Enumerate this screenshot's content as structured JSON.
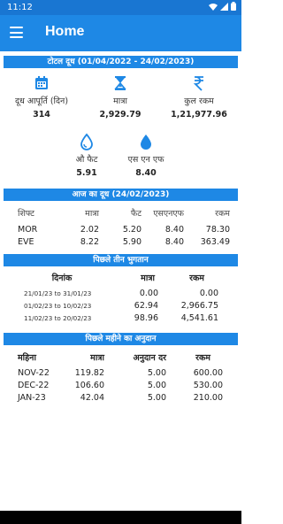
{
  "status": {
    "time": "11:12"
  },
  "app": {
    "title": "Home"
  },
  "total": {
    "heading": "टोटल दूध (01/04/2022 - 24/02/2023)",
    "stats": [
      {
        "label": "दूध आपूर्ति (दिन)",
        "value": "314",
        "icon": "calendar-icon"
      },
      {
        "label": "मात्रा",
        "value": "2,929.79",
        "icon": "hourglass-icon"
      },
      {
        "label": "कुल रकम",
        "value": "1,21,977.96",
        "icon": "rupee-icon"
      },
      {
        "label": "औ फैट",
        "value": "5.91",
        "icon": "drop-outline-icon"
      },
      {
        "label": "एस एन एफ",
        "value": "8.40",
        "icon": "drop-filled-icon"
      }
    ]
  },
  "today": {
    "heading": "आज का दूध (24/02/2023)",
    "headers": [
      "शिफ्ट",
      "मात्रा",
      "फैट",
      "एसएनएफ",
      "रकम"
    ],
    "rows": [
      [
        "MOR",
        "2.02",
        "5.20",
        "8.40",
        "78.30"
      ],
      [
        "EVE",
        "8.22",
        "5.90",
        "8.40",
        "363.49"
      ]
    ]
  },
  "payments": {
    "heading": "पिछले तीन भुगतान",
    "headers": [
      "दिनांक",
      "मात्रा",
      "रकम"
    ],
    "rows": [
      [
        "21/01/23 to 31/01/23",
        "0.00",
        "0.00"
      ],
      [
        "01/02/23 to 10/02/23",
        "62.94",
        "2,966.75"
      ],
      [
        "11/02/23 to 20/02/23",
        "98.96",
        "4,541.61"
      ]
    ]
  },
  "grant": {
    "heading": "पिछले महीने का अनुदान",
    "headers": [
      "महिना",
      "मात्रा",
      "अनुदान दर",
      "रकम"
    ],
    "rows": [
      [
        "NOV-22",
        "119.82",
        "5.00",
        "600.00"
      ],
      [
        "DEC-22",
        "106.60",
        "5.00",
        "530.00"
      ],
      [
        "JAN-23",
        "42.04",
        "5.00",
        "210.00"
      ]
    ]
  },
  "colors": {
    "primary": "#1e88e5",
    "status": "#1976d2"
  }
}
